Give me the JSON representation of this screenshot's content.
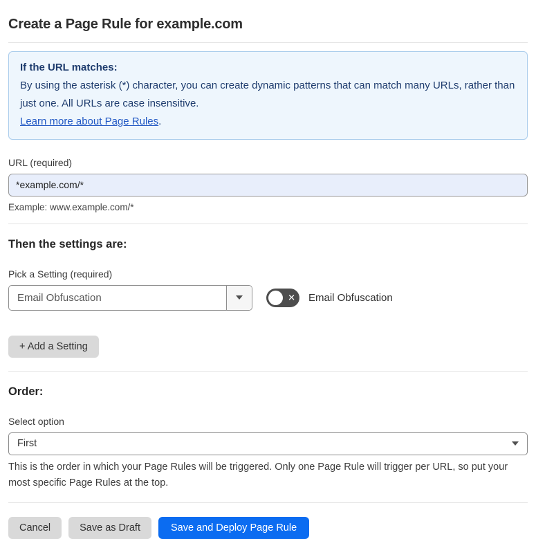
{
  "page": {
    "title": "Create a Page Rule for example.com"
  },
  "info_box": {
    "heading": "If the URL matches:",
    "body": "By using the asterisk (*) character, you can create dynamic patterns that can match many URLs, rather than just one. All URLs are case insensitive.",
    "link_label": "Learn more about Page Rules",
    "link_suffix": "."
  },
  "url_section": {
    "label": "URL (required)",
    "value": "*example.com/*",
    "example": "Example: www.example.com/*"
  },
  "settings_section": {
    "heading": "Then the settings are:",
    "picker_label": "Pick a Setting (required)",
    "picker_value": "Email Obfuscation",
    "toggle": {
      "label": "Email Obfuscation",
      "state": "off",
      "off_glyph": "✕"
    },
    "add_button_label": "+ Add a Setting"
  },
  "order_section": {
    "heading": "Order:",
    "select_label": "Select option",
    "select_value": "First",
    "help_text": "This is the order in which your Page Rules will be triggered. Only one Page Rule will trigger per URL, so put your most specific Page Rules at the top."
  },
  "footer": {
    "cancel_label": "Cancel",
    "save_draft_label": "Save as Draft",
    "deploy_label": "Save and Deploy Page Rule"
  },
  "colors": {
    "accent_blue": "#0b6cf1",
    "info_box_bg": "#eef6fd",
    "info_box_border": "#abcdec",
    "info_text": "#1e3c6e",
    "link_blue": "#2158c4",
    "url_input_bg": "#e8eefb",
    "gray_button_bg": "#d9d9d9",
    "toggle_off_bg": "#4d4d4d"
  }
}
